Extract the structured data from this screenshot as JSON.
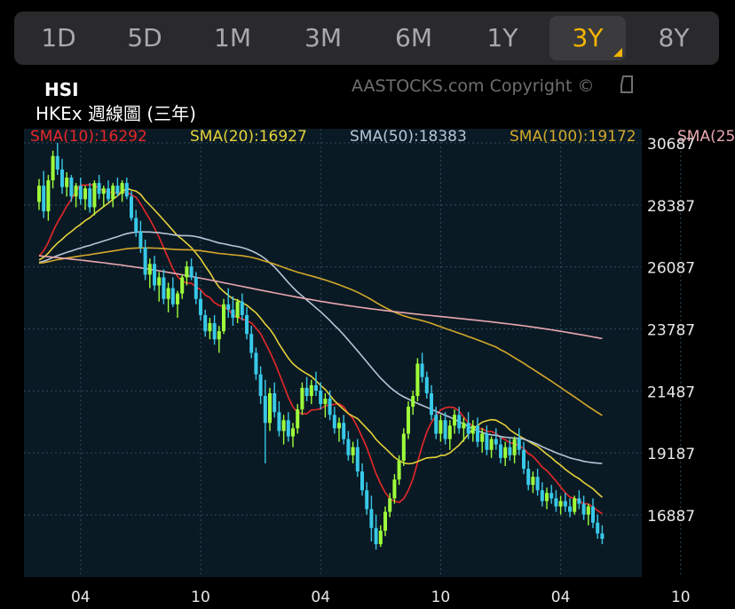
{
  "periods": [
    {
      "label": "1D",
      "active": false
    },
    {
      "label": "5D",
      "active": false
    },
    {
      "label": "1M",
      "active": false
    },
    {
      "label": "3M",
      "active": false
    },
    {
      "label": "6M",
      "active": false
    },
    {
      "label": "1Y",
      "active": false
    },
    {
      "label": "3Y",
      "active": true
    },
    {
      "label": "8Y",
      "active": false
    }
  ],
  "chart_title": "HSI",
  "chart_subtitle": "HKEx 週線圖 (三年)",
  "copyright": "AASTOCKS.com Copyright ©",
  "colors": {
    "background": "#000000",
    "plot_bg": "#0a1a24",
    "grid": "#2d4b5c",
    "up": "#9eff3a",
    "down": "#38c8e8",
    "sma10": "#e8282a",
    "sma20": "#e6d23a",
    "sma50": "#b8c4d8",
    "sma100": "#d4a82a",
    "sma250": "#e8a8b0",
    "axis_text": "#e8e8e8"
  },
  "sma_legend": [
    {
      "label": "SMA(10):16292",
      "key": "sma10"
    },
    {
      "label": "SMA(20):16927",
      "key": "sma20"
    },
    {
      "label": "SMA(50):18383",
      "key": "sma50"
    },
    {
      "label": "SMA(100):19172",
      "key": "sma100"
    },
    {
      "label": "SMA(25",
      "key": "sma250"
    }
  ],
  "chart_data": {
    "type": "candlestick",
    "interval": "weekly",
    "y_ticks": [
      "30687",
      "28387",
      "26087",
      "23787",
      "21487",
      "19187",
      "16887"
    ],
    "ylim": [
      15600,
      30687
    ],
    "x_ticks": [
      "04",
      "10",
      "04",
      "10",
      "04",
      "10"
    ],
    "x_tick_weeks": [
      9,
      35,
      61,
      87,
      113,
      139
    ],
    "candles": [
      [
        28500,
        29350,
        28200,
        29100
      ],
      [
        29100,
        29650,
        27900,
        28150
      ],
      [
        28150,
        29500,
        27800,
        29300
      ],
      [
        29300,
        30400,
        29000,
        30200
      ],
      [
        30200,
        30687,
        29500,
        29700
      ],
      [
        29700,
        30100,
        28800,
        29050
      ],
      [
        29050,
        29600,
        28700,
        29400
      ],
      [
        29400,
        29500,
        28500,
        28700
      ],
      [
        28700,
        29200,
        28300,
        29100
      ],
      [
        29100,
        29400,
        28400,
        28600
      ],
      [
        28600,
        29100,
        28200,
        29000
      ],
      [
        29000,
        29200,
        28100,
        28300
      ],
      [
        28300,
        29300,
        28000,
        29200
      ],
      [
        29200,
        29500,
        28600,
        28800
      ],
      [
        28800,
        29100,
        28300,
        29000
      ],
      [
        29000,
        29300,
        28500,
        28600
      ],
      [
        28600,
        29200,
        28300,
        29100
      ],
      [
        29100,
        29400,
        28700,
        28800
      ],
      [
        28800,
        29300,
        28500,
        29200
      ],
      [
        29200,
        29400,
        28600,
        28700
      ],
      [
        28700,
        28900,
        27800,
        27900
      ],
      [
        27900,
        28200,
        27200,
        27400
      ],
      [
        27400,
        27800,
        26600,
        26800
      ],
      [
        26800,
        27100,
        25600,
        25800
      ],
      [
        25800,
        26400,
        25300,
        26200
      ],
      [
        26200,
        26500,
        25200,
        25400
      ],
      [
        25400,
        25900,
        24800,
        25700
      ],
      [
        25700,
        26000,
        24700,
        24900
      ],
      [
        24900,
        25500,
        24400,
        25300
      ],
      [
        25300,
        25700,
        24600,
        24700
      ],
      [
        24700,
        25200,
        24200,
        25100
      ],
      [
        25100,
        25800,
        24900,
        25700
      ],
      [
        25700,
        26300,
        25400,
        26100
      ],
      [
        26100,
        26400,
        25600,
        25700
      ],
      [
        25700,
        25900,
        24700,
        24900
      ],
      [
        24900,
        25200,
        24100,
        24300
      ],
      [
        24300,
        24500,
        23500,
        23700
      ],
      [
        23700,
        24200,
        23400,
        24000
      ],
      [
        24000,
        24300,
        23200,
        23400
      ],
      [
        23400,
        23900,
        22900,
        23700
      ],
      [
        23700,
        24900,
        23600,
        24700
      ],
      [
        24700,
        25300,
        24200,
        24500
      ],
      [
        24500,
        25000,
        23900,
        24200
      ],
      [
        24200,
        24900,
        24000,
        24800
      ],
      [
        24800,
        25100,
        24100,
        24300
      ],
      [
        24300,
        24600,
        23400,
        23600
      ],
      [
        23600,
        23900,
        22700,
        22900
      ],
      [
        22900,
        23100,
        21900,
        22100
      ],
      [
        22100,
        22400,
        21000,
        21300
      ],
      [
        21300,
        21900,
        18800,
        20300
      ],
      [
        20300,
        21600,
        20000,
        21400
      ],
      [
        21400,
        21800,
        20500,
        20700
      ],
      [
        20700,
        21100,
        19800,
        20000
      ],
      [
        20000,
        20600,
        19500,
        20400
      ],
      [
        20400,
        20700,
        19600,
        19800
      ],
      [
        19800,
        20300,
        19400,
        20100
      ],
      [
        20100,
        21000,
        19900,
        20800
      ],
      [
        20800,
        21800,
        20600,
        21600
      ],
      [
        21600,
        22000,
        21100,
        21300
      ],
      [
        21300,
        21900,
        21000,
        21700
      ],
      [
        21700,
        22200,
        21300,
        21500
      ],
      [
        21500,
        21800,
        20800,
        21000
      ],
      [
        21000,
        21400,
        20500,
        21200
      ],
      [
        21200,
        21500,
        20400,
        20600
      ],
      [
        20600,
        20900,
        19900,
        20100
      ],
      [
        20100,
        20500,
        19600,
        20300
      ],
      [
        20300,
        20600,
        19500,
        19700
      ],
      [
        19700,
        20000,
        18900,
        19100
      ],
      [
        19100,
        19600,
        18800,
        19400
      ],
      [
        19400,
        19700,
        18300,
        18500
      ],
      [
        18500,
        18800,
        17600,
        17800
      ],
      [
        17800,
        18100,
        16900,
        17100
      ],
      [
        17100,
        17600,
        15900,
        16400
      ],
      [
        16400,
        16900,
        15600,
        15800
      ],
      [
        15800,
        16500,
        15700,
        16300
      ],
      [
        16300,
        17200,
        16100,
        17000
      ],
      [
        17000,
        17700,
        16800,
        17500
      ],
      [
        17500,
        18400,
        17300,
        18200
      ],
      [
        18200,
        19100,
        18000,
        18900
      ],
      [
        18900,
        20100,
        18700,
        19900
      ],
      [
        19900,
        21100,
        19700,
        20900
      ],
      [
        20900,
        21500,
        20600,
        21300
      ],
      [
        21300,
        22700,
        21100,
        22500
      ],
      [
        22500,
        22900,
        21800,
        22000
      ],
      [
        22000,
        22200,
        21200,
        21400
      ],
      [
        21400,
        21700,
        20400,
        20600
      ],
      [
        20600,
        20900,
        19700,
        19900
      ],
      [
        19900,
        20600,
        19600,
        20400
      ],
      [
        20400,
        20700,
        19500,
        19700
      ],
      [
        19700,
        20400,
        19300,
        20200
      ],
      [
        20200,
        20800,
        19900,
        20600
      ],
      [
        20600,
        20900,
        19900,
        20100
      ],
      [
        20100,
        20500,
        19600,
        20300
      ],
      [
        20300,
        20700,
        19700,
        19900
      ],
      [
        19900,
        20400,
        19600,
        20200
      ],
      [
        20200,
        20500,
        19400,
        19600
      ],
      [
        19600,
        20100,
        19200,
        19900
      ],
      [
        19900,
        20200,
        19100,
        19300
      ],
      [
        19300,
        19800,
        19000,
        19700
      ],
      [
        19700,
        20100,
        19300,
        19500
      ],
      [
        19500,
        19800,
        18800,
        19000
      ],
      [
        19000,
        19600,
        18700,
        19400
      ],
      [
        19400,
        19700,
        18900,
        19100
      ],
      [
        19100,
        19800,
        18800,
        19700
      ],
      [
        19700,
        20100,
        19100,
        19300
      ],
      [
        19300,
        19600,
        18400,
        18600
      ],
      [
        18600,
        18900,
        17800,
        18000
      ],
      [
        18000,
        18500,
        17700,
        18300
      ],
      [
        18300,
        18600,
        17600,
        17800
      ],
      [
        17800,
        18100,
        17200,
        17400
      ],
      [
        17400,
        17900,
        17100,
        17700
      ],
      [
        17700,
        18000,
        17300,
        17500
      ],
      [
        17500,
        17800,
        17000,
        17200
      ],
      [
        17200,
        17600,
        16900,
        17400
      ],
      [
        17400,
        17700,
        17000,
        17200
      ],
      [
        17200,
        17500,
        16800,
        17000
      ],
      [
        17000,
        17600,
        16900,
        17500
      ],
      [
        17500,
        17800,
        17100,
        17300
      ],
      [
        17300,
        17600,
        16700,
        16900
      ],
      [
        16900,
        17300,
        16500,
        17200
      ],
      [
        17200,
        17500,
        16400,
        16600
      ],
      [
        16600,
        16900,
        16000,
        16200
      ],
      [
        16200,
        16500,
        15800,
        16000
      ]
    ]
  }
}
